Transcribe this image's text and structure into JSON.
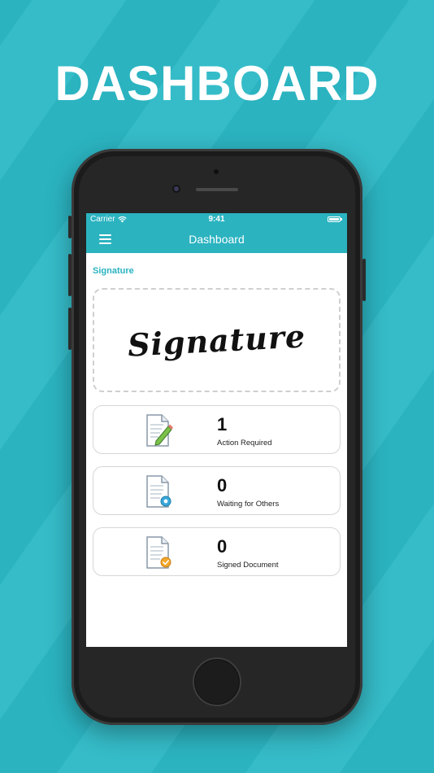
{
  "promo": {
    "headline": "DASHBOARD"
  },
  "status_bar": {
    "carrier": "Carrier",
    "time": "9:41"
  },
  "nav": {
    "title": "Dashboard",
    "menu_icon": "hamburger-menu-icon"
  },
  "signature": {
    "section_title": "Signature",
    "sample_text": "Signature"
  },
  "cards": [
    {
      "count": "1",
      "label": "Action Required",
      "icon": "document-pen-icon"
    },
    {
      "count": "0",
      "label": "Waiting for Others",
      "icon": "document-gear-icon"
    },
    {
      "count": "0",
      "label": "Signed Document",
      "icon": "document-check-icon"
    }
  ],
  "colors": {
    "accent": "#2bb3c0",
    "background": "#2bb3c0",
    "card_border": "#d6d6d6"
  }
}
